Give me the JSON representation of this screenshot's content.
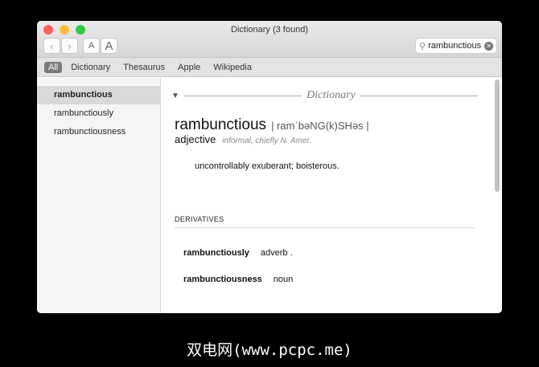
{
  "window": {
    "title": "Dictionary (3 found)"
  },
  "toolbar": {
    "back": "‹",
    "forward": "›",
    "font_smaller": "A",
    "font_larger": "A",
    "search_value": "rambunctious"
  },
  "scopes": [
    "All",
    "Dictionary",
    "Thesaurus",
    "Apple",
    "Wikipedia"
  ],
  "sidebar": {
    "items": [
      "rambunctious",
      "rambunctiously",
      "rambunctiousness"
    ]
  },
  "entry": {
    "section": "Dictionary",
    "headword": "rambunctious",
    "pronunciation": "| ramˈbəNG(k)SHəs |",
    "pos": "adjective",
    "register": "informal, chiefly N. Amer.",
    "definition": "uncontrollably exuberant; boisterous.",
    "derivatives_label": "DERIVATIVES",
    "derivatives": [
      {
        "word": "rambunctiously",
        "pos": "adverb ."
      },
      {
        "word": "rambunctiousness",
        "pos": "noun"
      }
    ]
  },
  "caption": "双电网(www.pcpc.me)"
}
